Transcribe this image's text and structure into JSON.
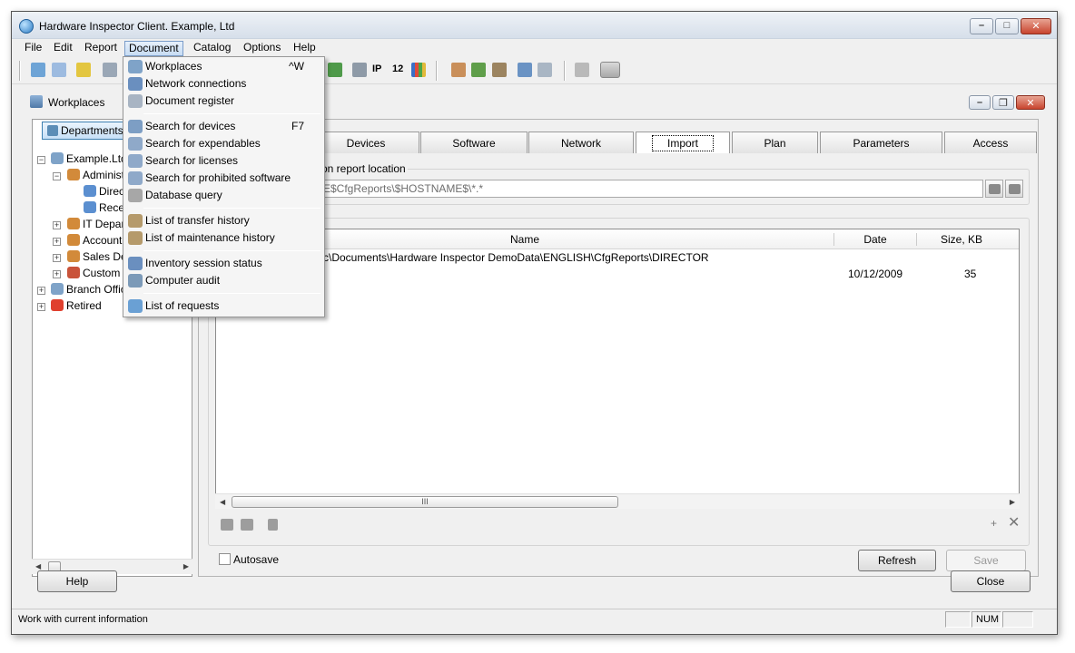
{
  "window": {
    "title": "Hardware Inspector Client. Example, Ltd"
  },
  "menubar": [
    "File",
    "Edit",
    "Report",
    "Document",
    "Catalog",
    "Options",
    "Help"
  ],
  "inner_window": {
    "title": "Workplaces"
  },
  "left": {
    "departments_label": "Departments",
    "tree": [
      {
        "label": "Example.Ltd",
        "level": 0
      },
      {
        "label": "Administration",
        "level": 1
      },
      {
        "label": "Director",
        "level": 2
      },
      {
        "label": "Reception",
        "level": 2
      },
      {
        "label": "IT Department",
        "level": 1
      },
      {
        "label": "Accounting",
        "level": 1
      },
      {
        "label": "Sales Department",
        "level": 1
      },
      {
        "label": "Custom",
        "level": 1
      },
      {
        "label": "Branch Office",
        "level": 0
      },
      {
        "label": "Retired",
        "level": 0
      }
    ]
  },
  "tabs": [
    "Devices",
    "Software",
    "Network",
    "Import",
    "Plan",
    "Parameters",
    "Access"
  ],
  "active_tab": "Import",
  "import": {
    "group_label": "on report location",
    "path_value": "E$CfgReports\\$HOSTNAME$\\*.*",
    "columns": {
      "name": "Name",
      "date": "Date",
      "size": "Size, KB"
    },
    "rows": [
      {
        "name": "c\\Documents\\Hardware Inspector DemoData\\ENGLISH\\CfgReports\\DIRECTOR",
        "date": "",
        "size": ""
      },
      {
        "name": "",
        "date": "10/12/2009",
        "size": "35"
      }
    ],
    "scroll_grip": "III",
    "autosave_label": "Autosave",
    "refresh_label": "Refresh",
    "save_label": "Save"
  },
  "footer": {
    "help_label": "Help",
    "close_label": "Close"
  },
  "statusbar": {
    "text": "Work with current information",
    "num": "NUM"
  },
  "document_menu": [
    {
      "label": "Workplaces",
      "shortcut": "^W"
    },
    {
      "label": "Network connections",
      "shortcut": ""
    },
    {
      "label": "Document register",
      "shortcut": ""
    },
    {
      "label": "Search for devices",
      "shortcut": "F7"
    },
    {
      "label": "Search for expendables",
      "shortcut": ""
    },
    {
      "label": "Search for licenses",
      "shortcut": ""
    },
    {
      "label": "Search for prohibited software",
      "shortcut": ""
    },
    {
      "label": "Database query",
      "shortcut": ""
    },
    {
      "label": "List of transfer history",
      "shortcut": ""
    },
    {
      "label": "List of maintenance history",
      "shortcut": ""
    },
    {
      "label": "Inventory session status",
      "shortcut": ""
    },
    {
      "label": "Computer audit",
      "shortcut": ""
    },
    {
      "label": "List of requests",
      "shortcut": ""
    }
  ],
  "toolbar_text": {
    "ip": "IP",
    "twelve": "12"
  },
  "colors": {
    "accent": "#3c7fb1",
    "menu_highlight": "#c7dcf3",
    "close_button": "#c8442e"
  }
}
